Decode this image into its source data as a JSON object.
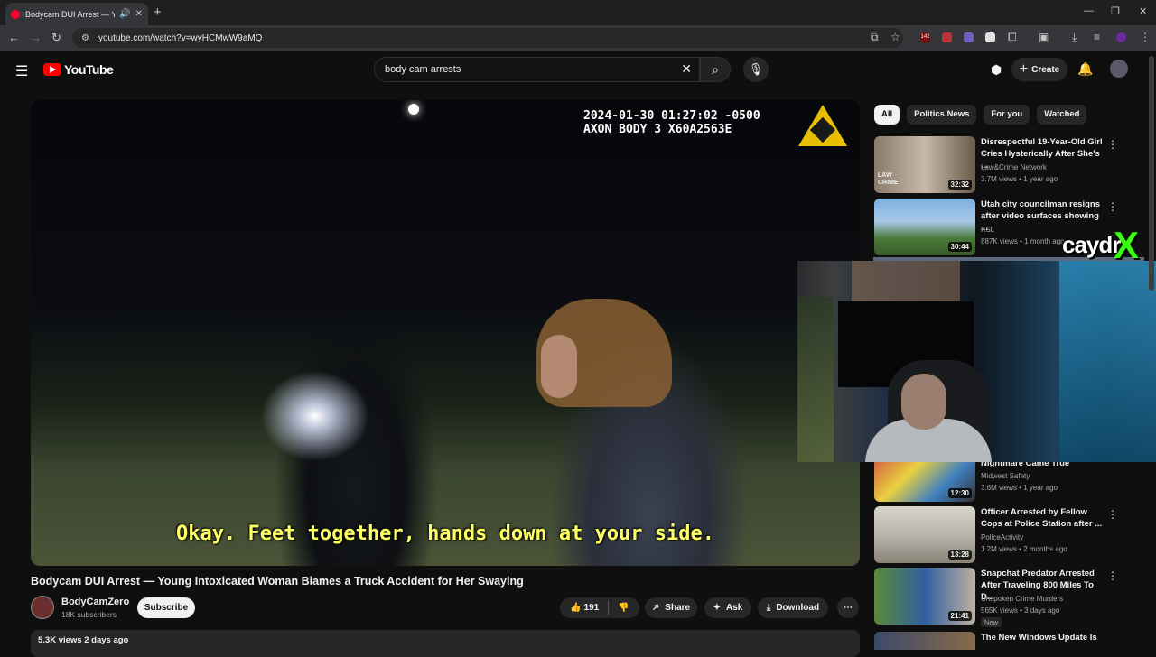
{
  "browser": {
    "tab_title": "Bodycam DUI Arrest — You",
    "url": "youtube.com/watch?v=wyHCMwW9aMQ",
    "ext_badge": "142"
  },
  "header": {
    "logo": "YouTube",
    "search_value": "body cam arrests",
    "create_label": "Create"
  },
  "video": {
    "timestamp_line1": "2024-01-30 01:27:02 -0500",
    "timestamp_line2": "AXON BODY 3 X60A2563E",
    "subtitle": "Okay. Feet together, hands down at your side.",
    "title": "Bodycam DUI Arrest — Young Intoxicated Woman Blames a Truck Accident for Her Swaying",
    "channel": "BodyCamZero",
    "subscribers": "18K subscribers",
    "subscribe_label": "Subscribe",
    "likes": "191",
    "share_label": "Share",
    "ask_label": "Ask",
    "download_label": "Download",
    "views_date": "5.3K views  2 days ago"
  },
  "sidebar": {
    "chips": [
      "All",
      "Politics News",
      "For you",
      "Watched"
    ],
    "recs": [
      {
        "title": "Disrespectful 19-Year-Old Girl Cries Hysterically After She's ...",
        "channel": "Law&Crime Network",
        "meta": "3.7M views • 1 year ago",
        "duration": "32:32",
        "thumb_text": "LAW CRIME"
      },
      {
        "title": "Utah city councilman resigns after video surfaces showing ...",
        "channel": "KSL",
        "meta": "887K views • 1 month ago",
        "duration": "30:44"
      },
      {
        "title": "Nightmare Came True",
        "channel": "Midwest Safety",
        "meta": "3.6M views • 1 year ago",
        "duration": "12:30"
      },
      {
        "title": "Officer Arrested by Fellow Cops at Police Station after ...",
        "channel": "PoliceActivity",
        "meta": "1.2M views • 2 months ago",
        "duration": "13:28"
      },
      {
        "title": "Snapchat Predator Arrested After Traveling 800 Miles To D...",
        "channel": "Unspoken Crime Murders",
        "meta": "565K views • 3 days ago",
        "duration": "21:41",
        "badge": "New"
      },
      {
        "title": "The New Windows Update Is"
      }
    ]
  },
  "overlay": {
    "streamer_name": "caydr",
    "streamer_mark": "X"
  },
  "colors": {
    "accent": "#ff0000",
    "subtitle": "#ffff66",
    "overlay_mark": "#39ff14"
  }
}
